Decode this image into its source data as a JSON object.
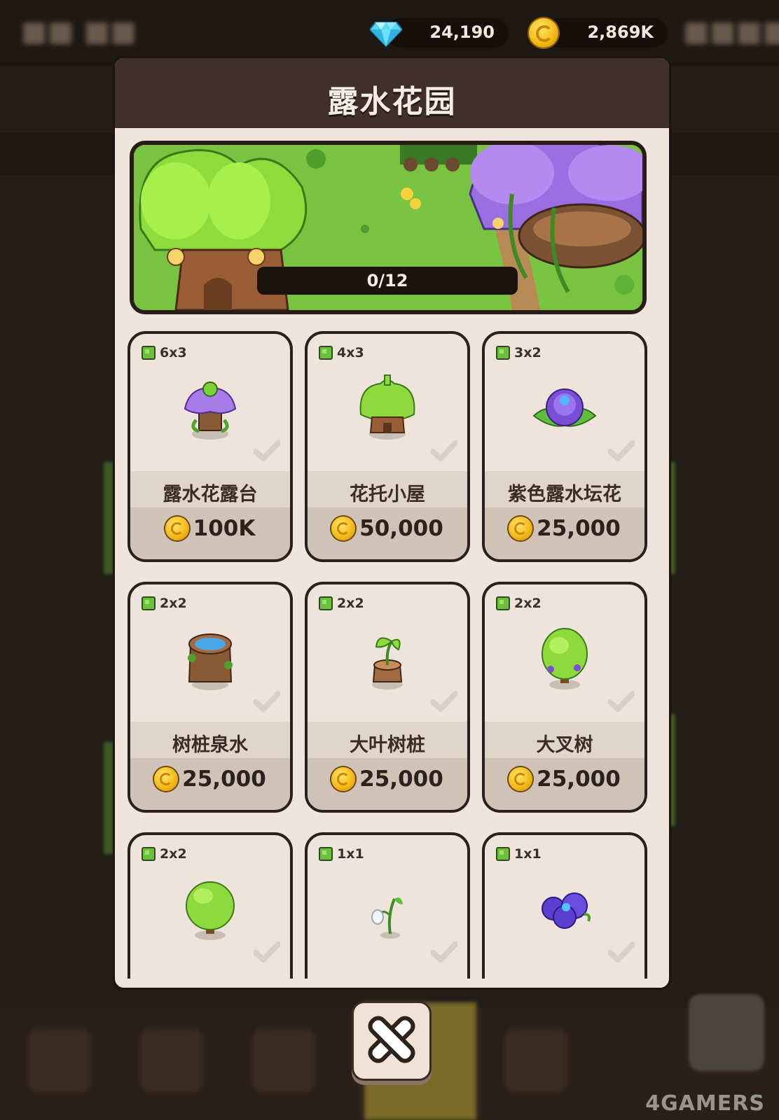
{
  "currencies": {
    "gems": {
      "icon": "diamond-icon",
      "value": "24,190"
    },
    "coins": {
      "icon": "gold-coin-icon",
      "value": "2,869K"
    }
  },
  "panel": {
    "title": "露水花园",
    "collection_progress": "0/12"
  },
  "items": [
    {
      "size": "6x3",
      "name": "露水花露台",
      "price": "100K",
      "icon": "dew-flower-terrace-icon"
    },
    {
      "size": "4x3",
      "name": "花托小屋",
      "price": "50,000",
      "icon": "receptacle-hut-icon"
    },
    {
      "size": "3x2",
      "name": "紫色露水坛花",
      "price": "25,000",
      "icon": "purple-dew-flower-icon"
    },
    {
      "size": "2x2",
      "name": "树桩泉水",
      "price": "25,000",
      "icon": "stump-spring-icon"
    },
    {
      "size": "2x2",
      "name": "大叶树桩",
      "price": "25,000",
      "icon": "big-leaf-stump-icon"
    },
    {
      "size": "2x2",
      "name": "大叉树",
      "price": "25,000",
      "icon": "big-fork-tree-icon"
    },
    {
      "size": "2x2",
      "name": "",
      "price": "",
      "icon": "round-bush-icon"
    },
    {
      "size": "1x1",
      "name": "",
      "price": "",
      "icon": "snowdrop-sprout-icon"
    },
    {
      "size": "1x1",
      "name": "",
      "price": "",
      "icon": "blue-flower-icon"
    }
  ],
  "watermark": "4GAMERS",
  "colors": {
    "panel_bg": "#efe5dc",
    "panel_header": "#41302a",
    "card_border": "#2b201b",
    "price_row": "#cfc2b7",
    "size_green": "#6bbf3d"
  }
}
